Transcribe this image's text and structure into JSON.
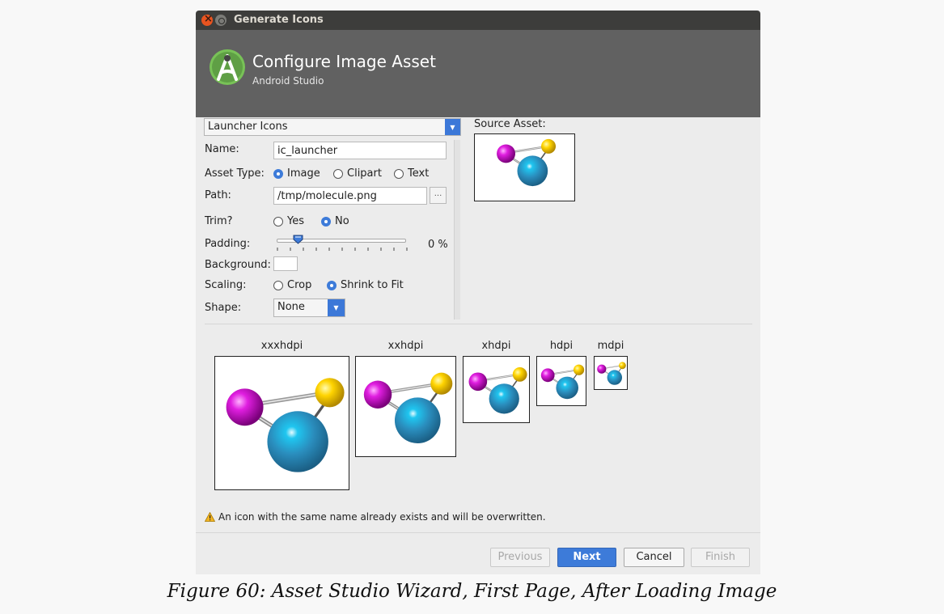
{
  "window": {
    "title": "Generate Icons",
    "colors": {
      "titlebar": "#3d3d3b",
      "banner": "#616161",
      "close": "#e95420",
      "accent": "#3d7bd9"
    }
  },
  "banner": {
    "icon": "android-studio-logo",
    "title": "Configure Image Asset",
    "subtitle": "Android Studio"
  },
  "form": {
    "icon_type": {
      "selected": "Launcher Icons"
    },
    "name": {
      "label": "Name:",
      "value": "ic_launcher"
    },
    "asset_type": {
      "label": "Asset Type:",
      "options": [
        "Image",
        "Clipart",
        "Text"
      ],
      "selected": "Image"
    },
    "path": {
      "label": "Path:",
      "value": "/tmp/molecule.png",
      "browse_label": "..."
    },
    "trim": {
      "label": "Trim?",
      "options": [
        "Yes",
        "No"
      ],
      "selected": "No"
    },
    "padding": {
      "label": "Padding:",
      "value_text": "0 %",
      "value": 0
    },
    "background": {
      "label": "Background:",
      "color": "#ffffff"
    },
    "scaling": {
      "label": "Scaling:",
      "options": [
        "Crop",
        "Shrink to Fit"
      ],
      "selected": "Shrink to Fit"
    },
    "shape": {
      "label": "Shape:",
      "selected": "None"
    }
  },
  "source_asset": {
    "label": "Source Asset:",
    "image": "molecule-image"
  },
  "previews": [
    {
      "density": "xxxhdpi"
    },
    {
      "density": "xxhdpi"
    },
    {
      "density": "xhdpi"
    },
    {
      "density": "hdpi"
    },
    {
      "density": "mdpi"
    }
  ],
  "warning": {
    "icon": "warning-icon",
    "text": "An icon with the same name already exists and will be overwritten."
  },
  "buttons": {
    "previous": "Previous",
    "next": "Next",
    "cancel": "Cancel",
    "finish": "Finish"
  },
  "caption": "Figure 60: Asset Studio Wizard, First Page, After Loading Image"
}
